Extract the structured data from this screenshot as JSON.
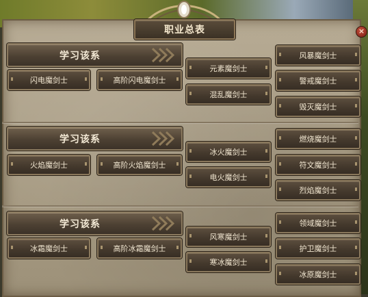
{
  "title": "职业总表",
  "close_symbol": "×",
  "sections": [
    {
      "learn_label": "学习该系",
      "base": [
        "闪电魔剑士",
        "高阶闪电魔剑士"
      ],
      "mid": [
        "元素魔剑士",
        "混乱魔剑士"
      ],
      "right": [
        "风暴魔剑士",
        "警戒魔剑士",
        "毁灭魔剑士"
      ]
    },
    {
      "learn_label": "学习该系",
      "base": [
        "火焰魔剑士",
        "高阶火焰魔剑士"
      ],
      "mid": [
        "冰火魔剑士",
        "电火魔剑士"
      ],
      "right": [
        "燃烧魔剑士",
        "符文魔剑士",
        "烈焰魔剑士"
      ]
    },
    {
      "learn_label": "学习该系",
      "base": [
        "冰霜魔剑士",
        "高阶冰霜魔剑士"
      ],
      "mid": [
        "风寒魔剑士",
        "寒冰魔剑士"
      ],
      "right": [
        "领域魔剑士",
        "护卫魔剑士",
        "冰原魔剑士"
      ]
    }
  ]
}
